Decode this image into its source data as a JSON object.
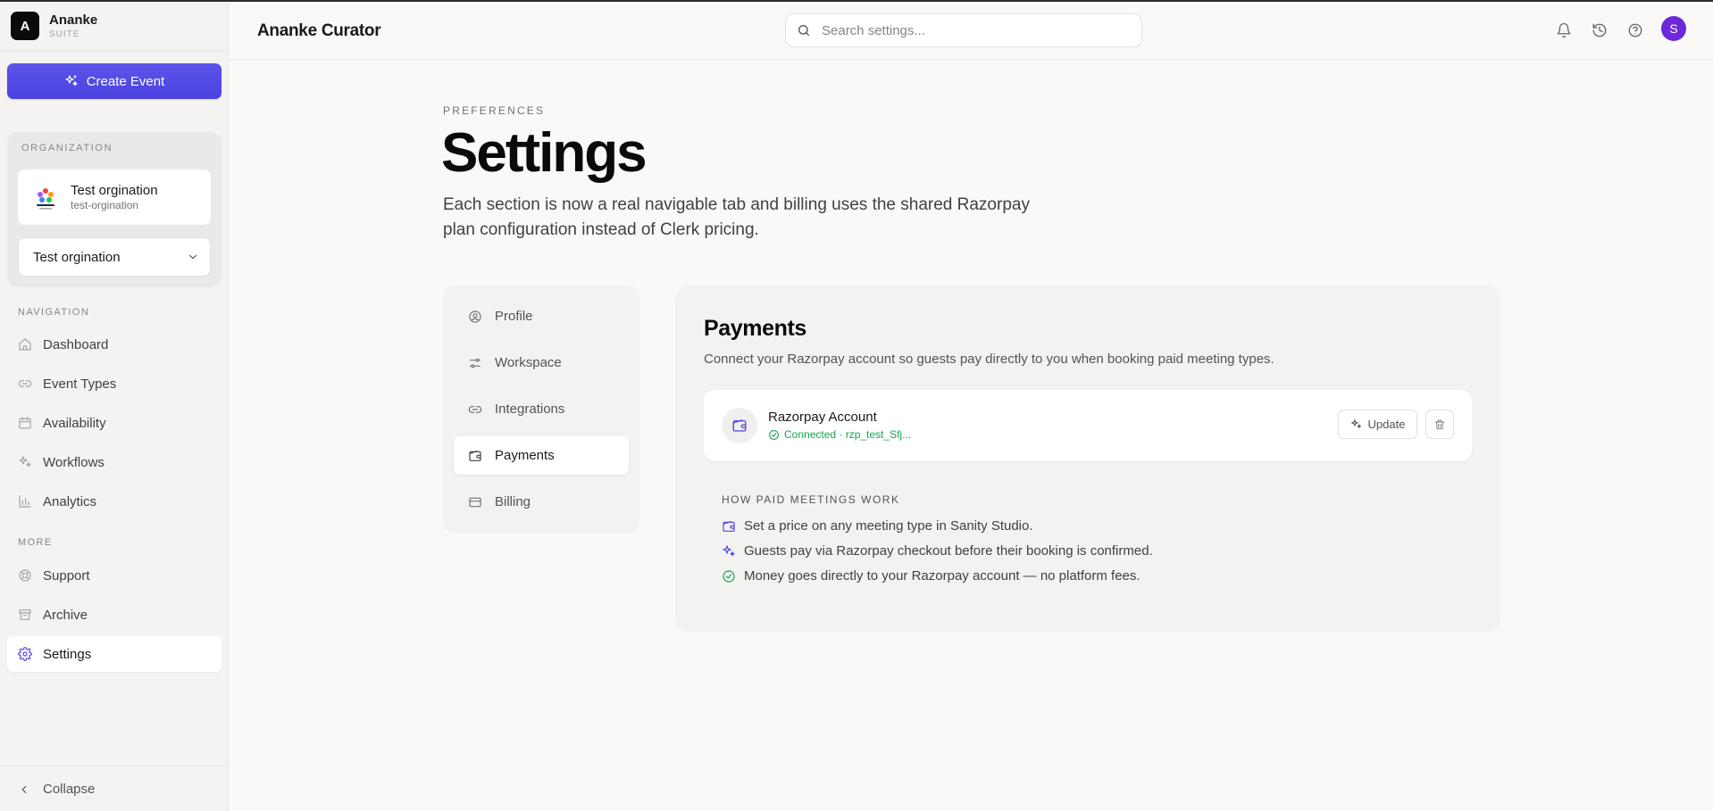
{
  "brand": {
    "logo_letter": "A",
    "name": "Ananke",
    "sub": "SUITE"
  },
  "sidebar": {
    "create_label": "Create Event",
    "org_section_label": "ORGANIZATION",
    "org_name": "Test orgination",
    "org_slug": "test-orgination",
    "org_select_value": "Test orgination",
    "nav_label": "NAVIGATION",
    "nav": [
      {
        "label": "Dashboard",
        "icon": "home-icon"
      },
      {
        "label": "Event Types",
        "icon": "link-icon"
      },
      {
        "label": "Availability",
        "icon": "calendar-icon"
      },
      {
        "label": "Workflows",
        "icon": "sparkle-icon"
      },
      {
        "label": "Analytics",
        "icon": "bar-chart-icon"
      }
    ],
    "more_label": "MORE",
    "more": [
      {
        "label": "Support",
        "icon": "lifebuoy-icon"
      },
      {
        "label": "Archive",
        "icon": "archive-icon"
      },
      {
        "label": "Settings",
        "icon": "gear-icon",
        "active": true
      }
    ],
    "collapse_label": "Collapse"
  },
  "header": {
    "title": "Ananke Curator",
    "search_placeholder": "Search settings...",
    "avatar_letter": "S",
    "avatar_color": "#6d28d9"
  },
  "page": {
    "eyebrow": "PREFERENCES",
    "title": "Settings",
    "description": "Each section is now a real navigable tab and billing uses the shared Razorpay plan configuration instead of Clerk pricing."
  },
  "tabs": [
    {
      "label": "Profile",
      "icon": "user-circle-icon"
    },
    {
      "label": "Workspace",
      "icon": "sliders-icon"
    },
    {
      "label": "Integrations",
      "icon": "link-icon"
    },
    {
      "label": "Payments",
      "icon": "wallet-icon",
      "active": true
    },
    {
      "label": "Billing",
      "icon": "credit-card-icon"
    }
  ],
  "payments": {
    "title": "Payments",
    "description": "Connect your Razorpay account so guests pay directly to you when booking paid meeting types.",
    "account": {
      "name": "Razorpay Account",
      "status": "Connected · rzp_test_Sfj...",
      "update_label": "Update"
    },
    "how_title": "HOW PAID MEETINGS WORK",
    "how_items": [
      {
        "text": "Set a price on any meeting type in Sanity Studio.",
        "icon": "wallet-icon"
      },
      {
        "text": "Guests pay via Razorpay checkout before their booking is confirmed.",
        "icon": "sparkle-icon"
      },
      {
        "text": "Money goes directly to your Razorpay account — no platform fees.",
        "icon": "check-circle-icon"
      }
    ]
  },
  "colors": {
    "accent": "#4f46e5",
    "success": "#16a34a",
    "avatar": "#6d28d9"
  }
}
